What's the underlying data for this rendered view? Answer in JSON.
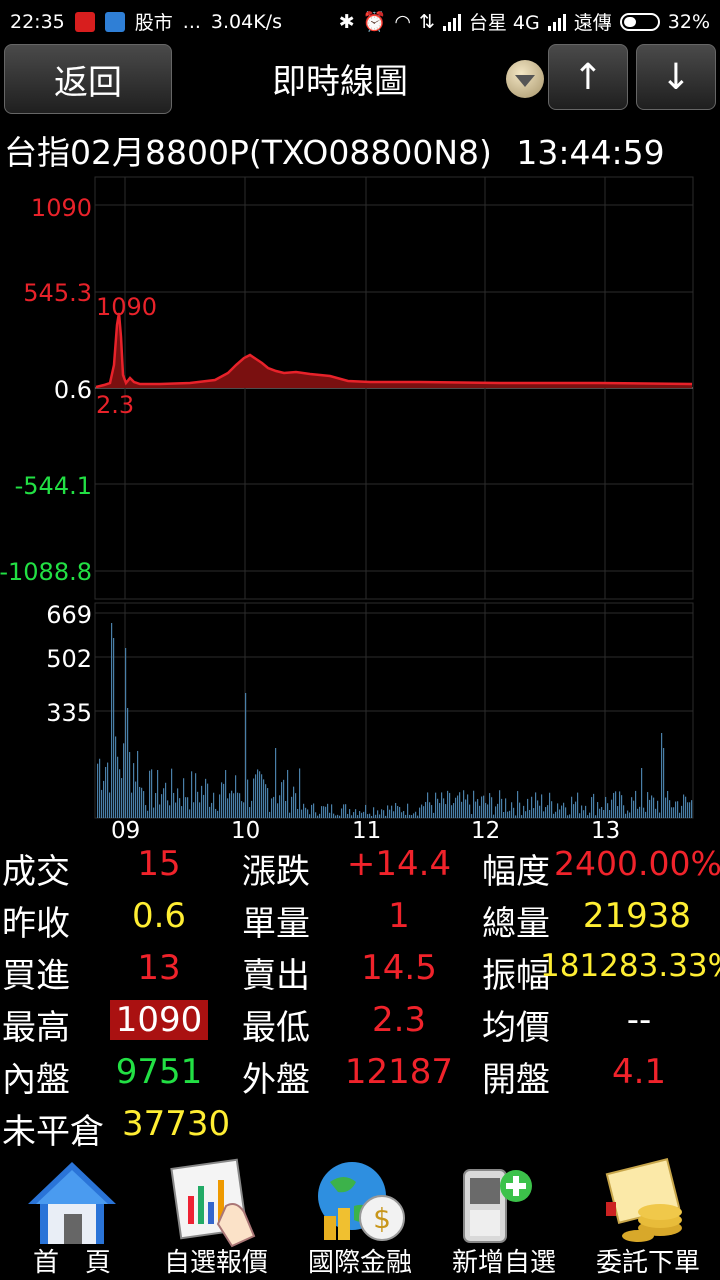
{
  "status_bar": {
    "time": "22:35",
    "app_label": "股市",
    "dots": "...",
    "speed": "3.04K/s",
    "carrier1": "台星 4G",
    "carrier2": "遠傳",
    "battery": "32%"
  },
  "header": {
    "back_label": "返回",
    "title": "即時線圖",
    "up_label": "↑",
    "down_label": "↓"
  },
  "instrument": {
    "name": "台指02月8800P(TXO08800N8)",
    "time": "13:44:59"
  },
  "price_chart": {
    "y_labels": [
      "1090",
      "545.3",
      "0.6",
      "-544.1",
      "-1088.8"
    ],
    "y_colors": [
      "#e8222a",
      "#e8222a",
      "#ffffff",
      "#22e044",
      "#22e044"
    ],
    "high_annotation": "1090",
    "low_annotation": "2.3",
    "line_color": "#e8222a",
    "fill_color": "#7a1010"
  },
  "volume_chart": {
    "y_labels": [
      "669",
      "502",
      "335"
    ],
    "bar_color": "#4a7fa8"
  },
  "x_labels": [
    "09",
    "10",
    "11",
    "12",
    "13"
  ],
  "stats": {
    "row1": {
      "l1": "成交",
      "v1": "15",
      "l2": "漲跌",
      "v2": "+14.4",
      "l3": "幅度",
      "v3": "2400.00%"
    },
    "row2": {
      "l1": "昨收",
      "v1": "0.6",
      "l2": "單量",
      "v2": "1",
      "l3": "總量",
      "v3": "21938"
    },
    "row3": {
      "l1": "買進",
      "v1": "13",
      "l2": "賣出",
      "v2": "14.5",
      "l3": "振幅",
      "v3": "181283.33%"
    },
    "row4": {
      "l1": "最高",
      "v1": "1090",
      "l2": "最低",
      "v2": "2.3",
      "l3": "均價",
      "v3": "--"
    },
    "row5": {
      "l1": "內盤",
      "v1": "9751",
      "l2": "外盤",
      "v2": "12187",
      "l3": "開盤",
      "v3": "4.1"
    },
    "row6": {
      "l1": "未平倉",
      "v1": "37730"
    }
  },
  "nav": [
    {
      "label": "首　頁",
      "icon": "home-icon"
    },
    {
      "label": "自選報價",
      "icon": "watchlist-chart-icon"
    },
    {
      "label": "國際金融",
      "icon": "globe-money-icon"
    },
    {
      "label": "新增自選",
      "icon": "add-phone-icon"
    },
    {
      "label": "委託下單",
      "icon": "order-coins-icon"
    }
  ]
}
